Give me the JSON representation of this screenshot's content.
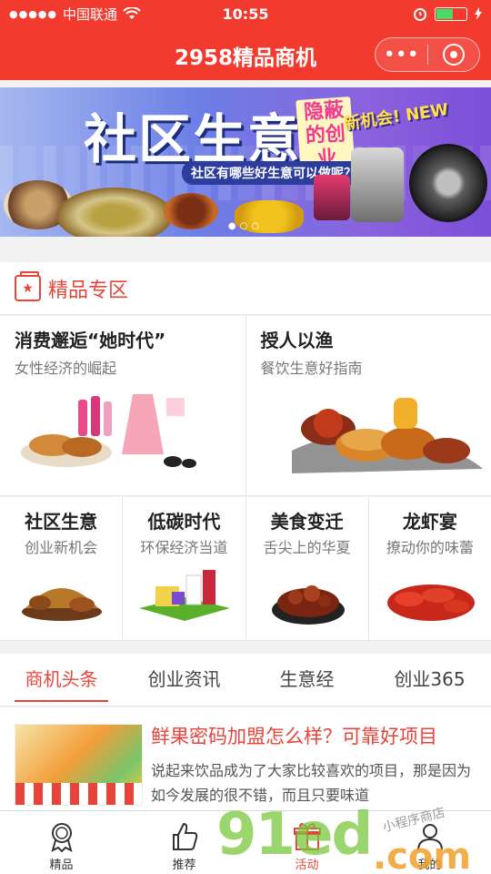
{
  "status_bar": {
    "signal": "●●●●●",
    "carrier": "中国联通",
    "time": "10:55"
  },
  "nav": {
    "title": "2958精品商机",
    "more_glyph": "•••"
  },
  "banner": {
    "title": "社区生意",
    "tag": "隐蔽的创业",
    "badge": "新机会! NEW",
    "subtitle": "社区有哪些好生意可以做呢？",
    "indicator": "●○○"
  },
  "section": {
    "icon": "star-bag-icon",
    "title": "精品专区"
  },
  "featured": [
    {
      "title": "消费邂逅“她时代”",
      "subtitle": "女性经济的崛起"
    },
    {
      "title": "授人以渔",
      "subtitle": "餐饮生意好指南"
    }
  ],
  "categories": [
    {
      "title": "社区生意",
      "subtitle": "创业新机会"
    },
    {
      "title": "低碳时代",
      "subtitle": "环保经济当道"
    },
    {
      "title": "美食变迁",
      "subtitle": "舌尖上的华夏"
    },
    {
      "title": "龙虾宴",
      "subtitle": "撩动你的味蕾"
    }
  ],
  "tabs": [
    {
      "label": "商机头条",
      "active": true
    },
    {
      "label": "创业资讯",
      "active": false
    },
    {
      "label": "生意经",
      "active": false
    },
    {
      "label": "创业365",
      "active": false
    }
  ],
  "news": [
    {
      "title": "鲜果密码加盟怎么样？可靠好项目",
      "desc": "说起来饮品成为了大家比较喜欢的项目，那是因为如今发展的很不错，而且只要味道"
    }
  ],
  "tabbar": [
    {
      "label": "精品",
      "icon": "medal-icon"
    },
    {
      "label": "推荐",
      "icon": "thumbs-up-icon"
    },
    {
      "label": "活动",
      "icon": "gift-icon"
    },
    {
      "label": "我的",
      "icon": "user-icon"
    }
  ],
  "watermark": {
    "main": "91ed",
    "suffix": ".com",
    "handwriting": "小程序商店"
  },
  "colors": {
    "brand_red": "#f23a2f",
    "accent_red": "#e8443a",
    "battery_green": "#4cd964"
  }
}
